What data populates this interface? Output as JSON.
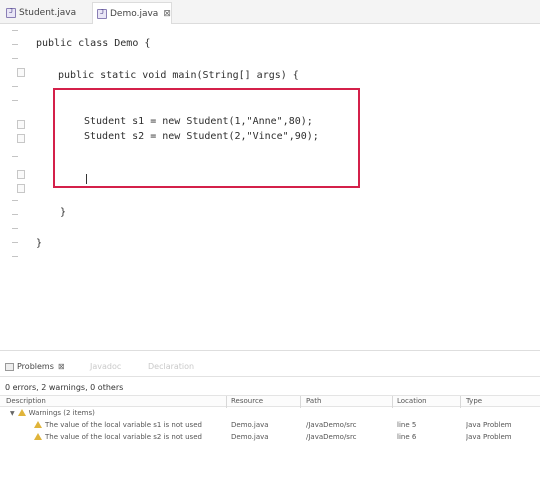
{
  "editor_tabs": [
    {
      "label": "Student.java",
      "active": false
    },
    {
      "label": "Demo.java",
      "active": true
    }
  ],
  "code_lines": [
    "public class Demo {",
    "public static void main(String[] args) {",
    "Student s1 = new Student(1,\"Anne\",80);",
    "Student s2 = new Student(2,\"Vince\",90);",
    "}",
    "}"
  ],
  "problems": {
    "tabs": [
      {
        "label": "Problems",
        "active": true
      },
      {
        "label": "Javadoc",
        "active": false
      },
      {
        "label": "Declaration",
        "active": false
      }
    ],
    "summary": "0 errors, 2 warnings, 0 others",
    "columns": [
      "Description",
      "Resource",
      "Path",
      "Location",
      "Type"
    ],
    "group": "Warnings (2 items)",
    "rows": [
      {
        "description": "The value of the local variable s1 is not used",
        "resource": "Demo.java",
        "path": "/JavaDemo/src",
        "location": "line 5",
        "type": "Java Problem"
      },
      {
        "description": "The value of the local variable s2 is not used",
        "resource": "Demo.java",
        "path": "/JavaDemo/src",
        "location": "line 6",
        "type": "Java Problem"
      }
    ]
  },
  "colors": {
    "highlight_box": "#d4204a",
    "warning": "#e0b43a"
  }
}
